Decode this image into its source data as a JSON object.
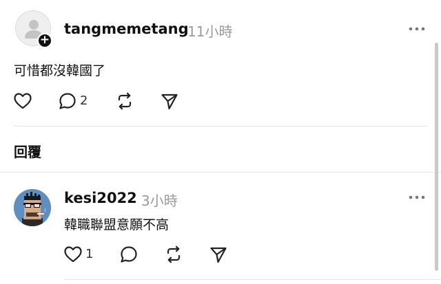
{
  "post": {
    "username": "tangmemetang",
    "time": "11小時",
    "text": "可惜都沒韓國了",
    "reply_count": "2"
  },
  "replies_section": {
    "title": "回覆"
  },
  "reply": {
    "username": "kesi2022",
    "time": "3小時",
    "text": "韓職聯盟意願不高",
    "like_count": "1"
  },
  "icons": {
    "avatar": "default-user-avatar",
    "follow": "plus-icon",
    "more": "more-icon",
    "like": "heart-icon",
    "comment": "comment-icon",
    "repost": "repost-icon",
    "share": "send-icon"
  },
  "colors": {
    "text": "#111111",
    "muted": "#9a9a9a",
    "divider": "#e6e6e6",
    "avatar_bg": "#5e8fc0"
  }
}
